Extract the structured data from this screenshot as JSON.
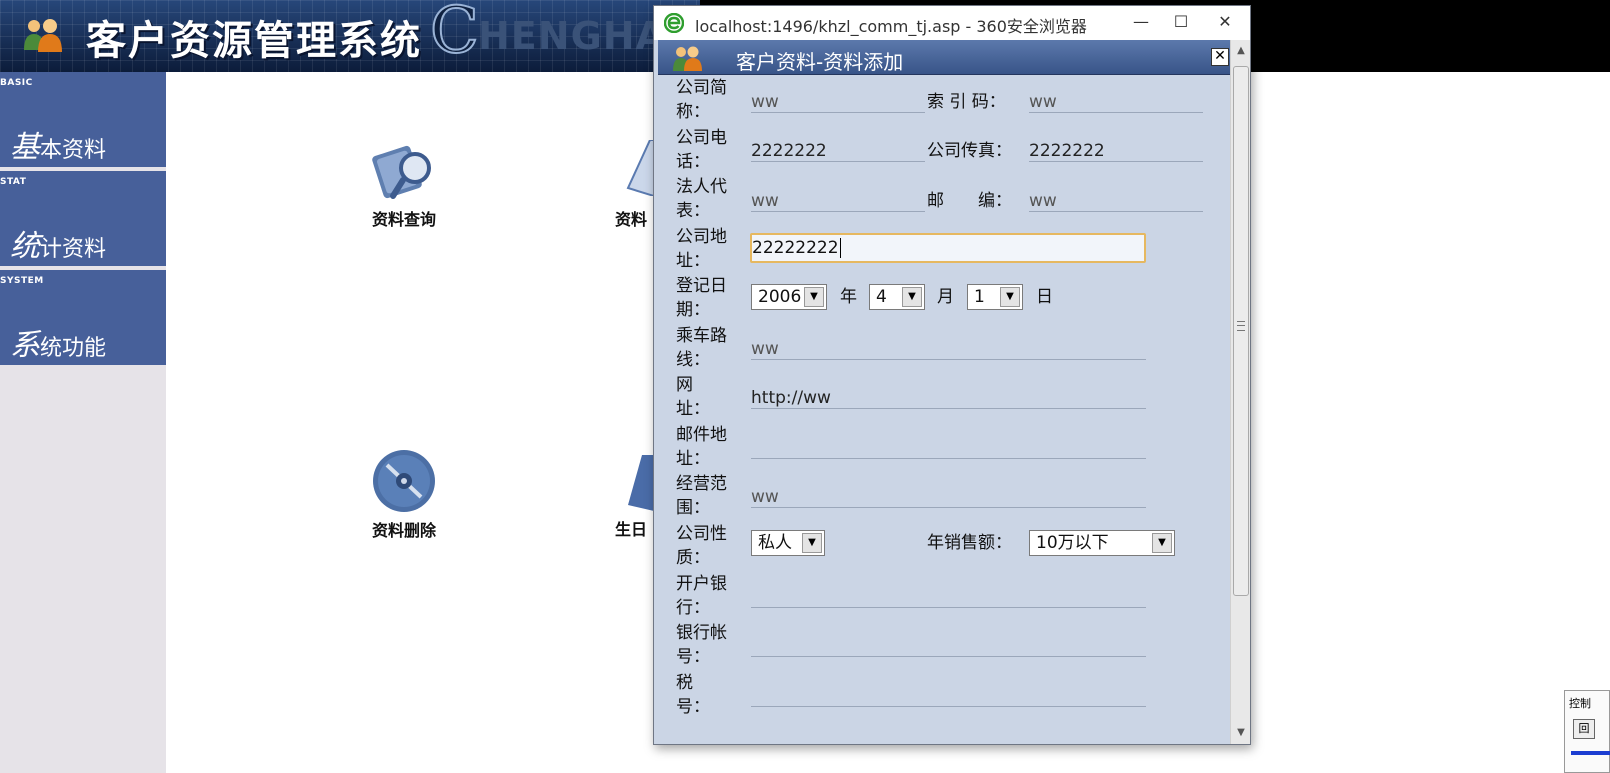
{
  "app": {
    "title": "客户资源管理系统",
    "brand_c": "C",
    "brand_text": "HENGHA"
  },
  "sidebar": {
    "items": [
      {
        "tag": "BASIC",
        "big": "基",
        "small": "本资料"
      },
      {
        "tag": "STAT",
        "big": "统",
        "small": "计资料"
      },
      {
        "tag": "SYSTEM",
        "big": "系",
        "small": "统功能"
      }
    ]
  },
  "tiles": {
    "query": "资料查询",
    "delete": "资料删除",
    "partial_top": "资料",
    "partial_bottom": "生日"
  },
  "popup": {
    "window_title": "localhost:1496/khzl_comm_tj.asp - 360安全浏览器",
    "min_glyph": "—",
    "max_glyph": "☐",
    "close_glyph": "✕",
    "header_title": "客户资料-资料添加",
    "header_close": "✕",
    "scroll_up": "▲",
    "scroll_down": "▼"
  },
  "form": {
    "short_name_label": "公司简称：",
    "short_name": "ww",
    "index_code_label": "索 引 码：",
    "index_code": "ww",
    "phone_label": "公司电话：",
    "phone": "2222222",
    "fax_label": "公司传真：",
    "fax": "2222222",
    "legal_rep_label": "法人代表：",
    "legal_rep": "ww",
    "postcode_label": "邮　　编：",
    "postcode": "ww",
    "address_label": "公司地址：",
    "address": "22222222",
    "reg_date_label": "登记日期：",
    "year": "2006",
    "year_unit": "年",
    "month": "4",
    "month_unit": "月",
    "day": "1",
    "day_unit": "日",
    "route_label": "乘车路线：",
    "route": "ww",
    "website_label": "网　　址：",
    "website": "http://ww",
    "email_label": "邮件地址：",
    "email": "",
    "scope_label": "经营范围：",
    "scope": "ww",
    "nature_label": "公司性质：",
    "nature": "私人",
    "sales_label": "年销售额：",
    "sales": "10万以下",
    "bank_label": "开户银行：",
    "bank": "",
    "account_label": "银行帐号：",
    "account": "",
    "tax_label": "税　　号：",
    "tax": "",
    "arrow": "▼"
  },
  "control_panel": {
    "label": "控制",
    "button": "回"
  }
}
